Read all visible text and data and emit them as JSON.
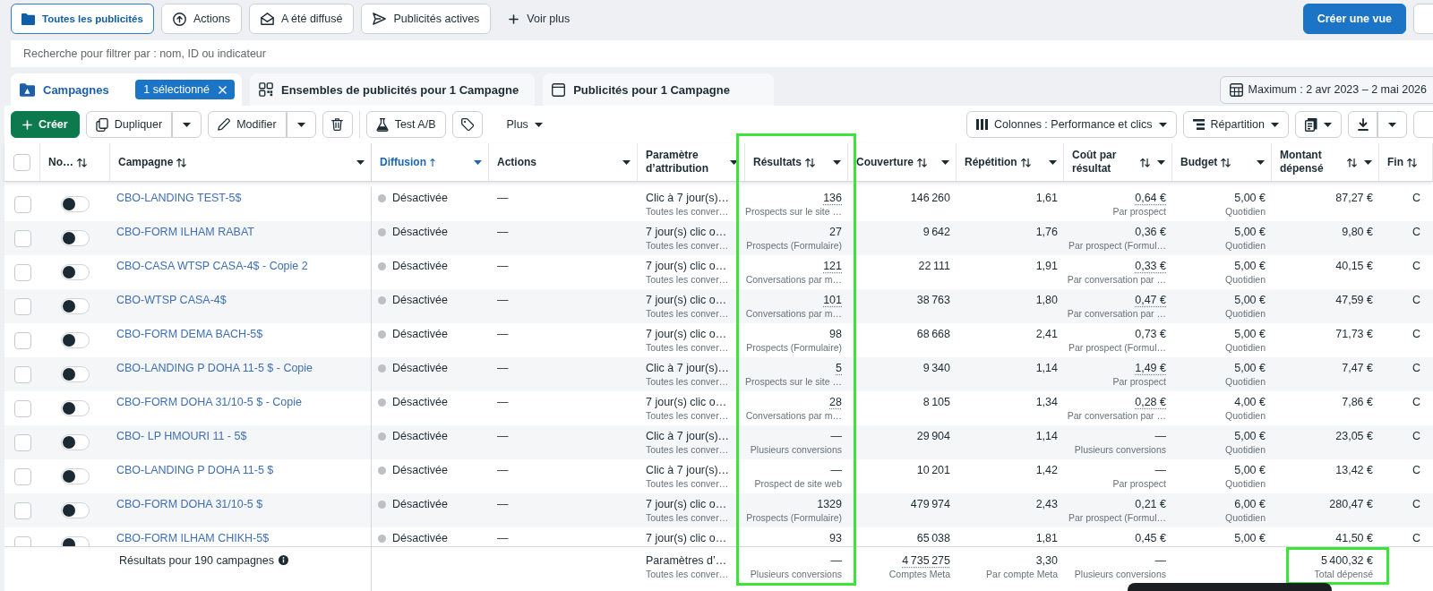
{
  "filter_bar": {
    "presets": [
      {
        "label": "Toutes les publicités",
        "selected": true
      },
      {
        "label": "Actions",
        "selected": false
      },
      {
        "label": "A été diffusé",
        "selected": false
      },
      {
        "label": "Publicités actives",
        "selected": false
      }
    ],
    "more": "Voir plus",
    "create_view": "Créer une vue"
  },
  "search": {
    "placeholder": "Recherche pour filtrer par : nom, ID ou indicateur"
  },
  "tabs": [
    {
      "label": "Campagnes",
      "selected": true,
      "badge": "1 sélectionné"
    },
    {
      "label": "Ensembles de publicités pour 1 Campagne",
      "selected": false
    },
    {
      "label": "Publicités pour 1 Campagne",
      "selected": false
    }
  ],
  "date_range": "Maximum : 2 avr 2023 – 2 mai 2026",
  "toolbar": {
    "create": "Créer",
    "duplicate": "Dupliquer",
    "edit": "Modifier",
    "ab_test": "Test A/B",
    "more": "Plus",
    "columns": "Colonnes : Performance et clics",
    "breakdown": "Répartition"
  },
  "table": {
    "select_all_checked": false,
    "columns": [
      {
        "label": "No…",
        "sortable": true,
        "sorted": false,
        "dropdown": false,
        "highlighted": false
      },
      {
        "label": "Campagne",
        "sortable": true,
        "sorted": false,
        "dropdown": true,
        "highlighted": false
      },
      {
        "label": "Diffusion",
        "sortable": true,
        "sorted": true,
        "dropdown": true,
        "highlighted": false
      },
      {
        "label": "Actions",
        "sortable": false,
        "sorted": false,
        "dropdown": true,
        "highlighted": false
      },
      {
        "label": "Paramètre d’attribution",
        "sortable": false,
        "sorted": false,
        "dropdown": true,
        "highlighted": false
      },
      {
        "label": "Résultats",
        "sortable": true,
        "sorted": false,
        "dropdown": true,
        "highlighted": true
      },
      {
        "label": "Couverture",
        "sortable": true,
        "sorted": false,
        "dropdown": true,
        "highlighted": false
      },
      {
        "label": "Répétition",
        "sortable": true,
        "sorted": false,
        "dropdown": true,
        "highlighted": false
      },
      {
        "label": "Coût par résultat",
        "sortable": true,
        "sorted": false,
        "dropdown": true,
        "highlighted": false
      },
      {
        "label": "Budget",
        "sortable": true,
        "sorted": false,
        "dropdown": true,
        "highlighted": false
      },
      {
        "label": "Montant dépensé",
        "sortable": true,
        "sorted": false,
        "dropdown": true,
        "highlighted": false
      },
      {
        "label": "Fin",
        "sortable": true,
        "sorted": false,
        "dropdown": false,
        "highlighted": false
      }
    ],
    "rows": [
      {
        "selected": false,
        "on": false,
        "name": "CBO-LANDING TEST-5$",
        "status": "Désactivée",
        "actions": "—",
        "attribution": "Clic à 7 jour(s)…",
        "attribution_note": "Toutes les conver…",
        "results": "136",
        "results_note": "Prospects sur le site …",
        "dotted": true,
        "reach": "146 260",
        "frequency": "1,61",
        "cost": "0,64 €",
        "cost_note": "Par prospect",
        "budget": "5,00 €",
        "budget_note": "Quotidien",
        "spent": "87,27 €",
        "end": "C"
      },
      {
        "selected": false,
        "on": false,
        "name": "CBO-FORM ILHAM RABAT",
        "status": "Désactivée",
        "actions": "—",
        "attribution": "7 jour(s) clic o…",
        "attribution_note": "Toutes les conver…",
        "results": "27",
        "results_note": "Prospects (Formulaire)",
        "dotted": false,
        "reach": "9 642",
        "frequency": "1,76",
        "cost": "0,36 €",
        "cost_note": "Par prospect (Formul…",
        "budget": "5,00 €",
        "budget_note": "Quotidien",
        "spent": "9,80 €",
        "end": "C"
      },
      {
        "selected": false,
        "on": false,
        "name": "CBO-CASA WTSP CASA-4$ - Copie 2",
        "status": "Désactivée",
        "actions": "—",
        "attribution": "7 jour(s) clic o…",
        "attribution_note": "Toutes les conver…",
        "results": "121",
        "results_note": "Conversations par m…",
        "dotted": true,
        "reach": "22 111",
        "frequency": "1,91",
        "cost": "0,33 €",
        "cost_note": "Par conversation par …",
        "budget": "5,00 €",
        "budget_note": "Quotidien",
        "spent": "40,15 €",
        "end": "C"
      },
      {
        "selected": false,
        "on": false,
        "name": "CBO-WTSP CASA-4$",
        "status": "Désactivée",
        "actions": "—",
        "attribution": "7 jour(s) clic o…",
        "attribution_note": "Toutes les conver…",
        "results": "101",
        "results_note": "Conversations par m…",
        "dotted": true,
        "reach": "38 763",
        "frequency": "1,80",
        "cost": "0,47 €",
        "cost_note": "Par conversation par …",
        "budget": "5,00 €",
        "budget_note": "Quotidien",
        "spent": "47,59 €",
        "end": "C"
      },
      {
        "selected": false,
        "on": false,
        "name": "CBO-FORM DEMA BACH-5$",
        "status": "Désactivée",
        "actions": "—",
        "attribution": "7 jour(s) clic o…",
        "attribution_note": "Toutes les conver…",
        "results": "98",
        "results_note": "Prospects (Formulaire)",
        "dotted": false,
        "reach": "68 668",
        "frequency": "2,41",
        "cost": "0,73 €",
        "cost_note": "Par prospect (Formul…",
        "budget": "5,00 €",
        "budget_note": "Quotidien",
        "spent": "71,73 €",
        "end": "C"
      },
      {
        "selected": false,
        "on": false,
        "name": "CBO-LANDING P DOHA 11-5 $ - Copie",
        "status": "Désactivée",
        "actions": "—",
        "attribution": "Clic à 7 jour(s)…",
        "attribution_note": "Toutes les conver…",
        "results": "5",
        "results_note": "Prospects sur le site …",
        "dotted": true,
        "reach": "9 340",
        "frequency": "1,14",
        "cost": "1,49 €",
        "cost_note": "Par prospect",
        "budget": "5,00 €",
        "budget_note": "Quotidien",
        "spent": "7,47 €",
        "end": "C"
      },
      {
        "selected": false,
        "on": false,
        "name": "CBO-FORM DOHA 31/10-5 $ - Copie",
        "status": "Désactivée",
        "actions": "—",
        "attribution": "7 jour(s) clic o…",
        "attribution_note": "Toutes les conver…",
        "results": "28",
        "results_note": "Conversations par m…",
        "dotted": true,
        "reach": "8 105",
        "frequency": "1,34",
        "cost": "0,28 €",
        "cost_note": "Par conversation par …",
        "budget": "4,00 €",
        "budget_note": "Quotidien",
        "spent": "7,86 €",
        "end": "C"
      },
      {
        "selected": false,
        "on": false,
        "name": "CBO- LP HMOURI 11 - 5$",
        "status": "Désactivée",
        "actions": "—",
        "attribution": "Clic à 7 jour(s)…",
        "attribution_note": "Toutes les conver…",
        "results": "—",
        "results_note": "Plusieurs conversions",
        "dotted": false,
        "reach": "29 904",
        "frequency": "1,14",
        "cost": "—",
        "cost_note": "Plusieurs conversions",
        "budget": "5,00 €",
        "budget_note": "Quotidien",
        "spent": "23,05 €",
        "end": "C"
      },
      {
        "selected": false,
        "on": false,
        "name": "CBO-LANDING P DOHA 11-5 $",
        "status": "Désactivée",
        "actions": "—",
        "attribution": "Clic à 7 jour(s)…",
        "attribution_note": "Toutes les conver…",
        "results": "—",
        "results_note": "Prospect de site web",
        "dotted": false,
        "reach": "10 201",
        "frequency": "1,42",
        "cost": "—",
        "cost_note": "Par prospect",
        "budget": "5,00 €",
        "budget_note": "Quotidien",
        "spent": "13,42 €",
        "end": "C"
      },
      {
        "selected": false,
        "on": false,
        "name": "CBO-FORM DOHA 31/10-5 $",
        "status": "Désactivée",
        "actions": "—",
        "attribution": "7 jour(s) clic o…",
        "attribution_note": "Toutes les conver…",
        "results": "1329",
        "results_note": "Prospects (Formulaire)",
        "dotted": false,
        "reach": "479 974",
        "frequency": "2,43",
        "cost": "0,21 €",
        "cost_note": "Par prospect (Formul…",
        "budget": "6,00 €",
        "budget_note": "Quotidien",
        "spent": "280,47 €",
        "end": "C"
      },
      {
        "selected": false,
        "on": false,
        "name": "CBO-FORM ILHAM CHIKH-5$",
        "status": "Désactivée",
        "actions": "—",
        "attribution": "7 jour(s) clic o…",
        "results": "93",
        "dotted": false,
        "reach": "65 038",
        "frequency": "1,81",
        "cost": "0,45 €",
        "budget": "5,00 €",
        "spent": "41,50 €",
        "end": "C"
      }
    ],
    "footer": {
      "summary": "Résultats pour 190 campagnes",
      "attribution": "Paramètres d’…",
      "attribution_note": "Toutes les conver…",
      "results": "—",
      "results_note": "Plusieurs conversions",
      "reach": "4 735 275",
      "reach_dotted": true,
      "reach_note": "Comptes Meta",
      "frequency": "3,30",
      "frequency_note": "Par compte Meta",
      "cost": "—",
      "cost_note": "Plusieurs conversions",
      "spent": "5 400,32 €",
      "spent_note": "Total dépensé",
      "spent_highlighted": true
    }
  }
}
